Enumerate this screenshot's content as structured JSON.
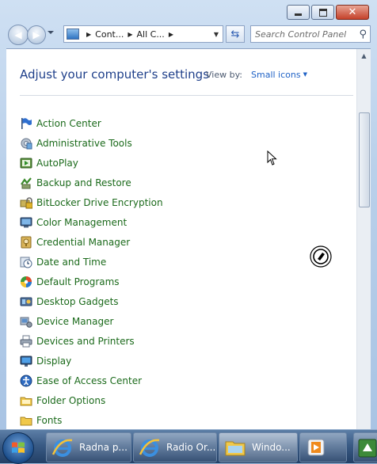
{
  "window": {
    "controls": {
      "minimize": "minimize",
      "maximize": "maximize",
      "close": "✕"
    }
  },
  "address_bar": {
    "crumbs": [
      "Cont...",
      "All C..."
    ]
  },
  "search": {
    "placeholder": "Search Control Panel"
  },
  "header": {
    "title": "Adjust your computer's settings",
    "view_by_label": "View by:",
    "view_by_value": "Small icons"
  },
  "items": [
    {
      "label": "Action Center",
      "icon": "flag-icon"
    },
    {
      "label": "Administrative Tools",
      "icon": "admin-tools-icon"
    },
    {
      "label": "AutoPlay",
      "icon": "autoplay-icon"
    },
    {
      "label": "Backup and Restore",
      "icon": "backup-icon"
    },
    {
      "label": "BitLocker Drive Encryption",
      "icon": "bitlocker-icon"
    },
    {
      "label": "Color Management",
      "icon": "monitor-icon"
    },
    {
      "label": "Credential Manager",
      "icon": "credential-icon"
    },
    {
      "label": "Date and Time",
      "icon": "clock-icon"
    },
    {
      "label": "Default Programs",
      "icon": "default-programs-icon"
    },
    {
      "label": "Desktop Gadgets",
      "icon": "gadgets-icon"
    },
    {
      "label": "Device Manager",
      "icon": "device-manager-icon"
    },
    {
      "label": "Devices and Printers",
      "icon": "printer-icon"
    },
    {
      "label": "Display",
      "icon": "display-icon"
    },
    {
      "label": "Ease of Access Center",
      "icon": "ease-of-access-icon"
    },
    {
      "label": "Folder Options",
      "icon": "folder-icon"
    },
    {
      "label": "Fonts",
      "icon": "fonts-icon"
    }
  ],
  "taskbar": {
    "apps": [
      {
        "label": "Radna p...",
        "icon": "internet-explorer-icon"
      },
      {
        "label": "Radio Or...",
        "icon": "internet-explorer-icon"
      },
      {
        "label": "Windo...",
        "icon": "explorer-folder-icon"
      }
    ]
  },
  "colors": {
    "link_green": "#1b6a1b",
    "heading_blue": "#1e3f8a",
    "view_value_blue": "#1f62c6"
  }
}
